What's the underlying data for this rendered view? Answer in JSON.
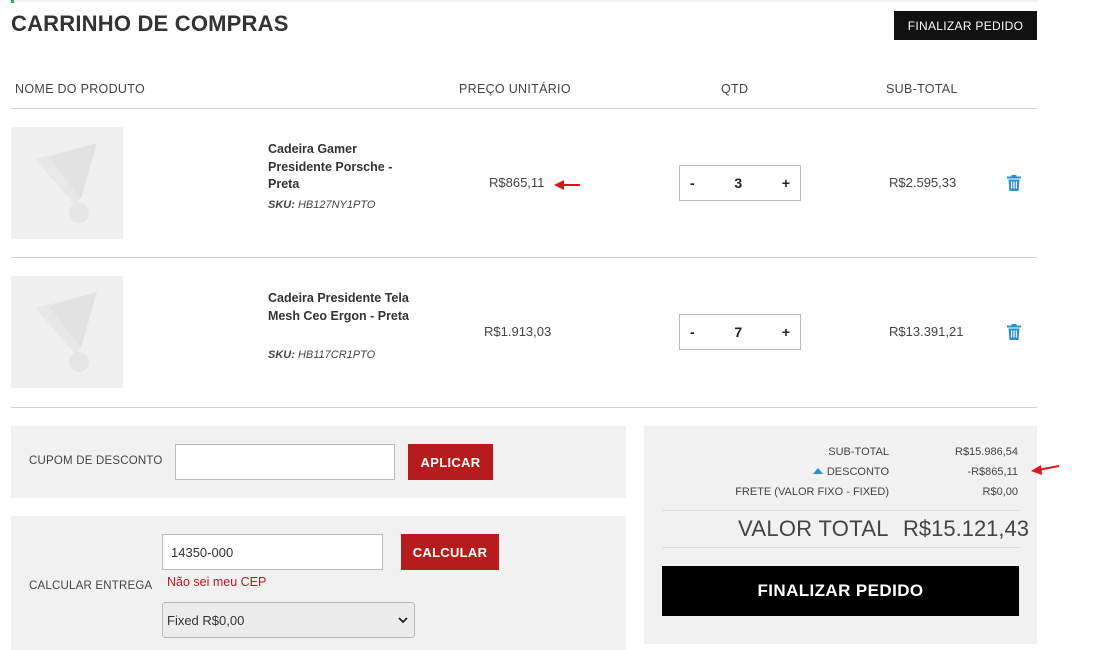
{
  "header": {
    "title": "CARRINHO DE COMPRAS",
    "checkout_top_label": "FINALIZAR PEDIDO"
  },
  "table_headers": {
    "product": "NOME DO PRODUTO",
    "unit_price": "PREÇO UNITÁRIO",
    "qty": "QTD",
    "subtotal": "SUB-TOTAL"
  },
  "items": [
    {
      "name": "Cadeira Gamer Presidente Porsche - Preta",
      "sku_label": "SKU:",
      "sku": "HB127NY1PTO",
      "unit_price": "R$865,11",
      "qty": "3",
      "minus": "-",
      "plus": "+",
      "subtotal": "R$2.595,33",
      "image_icon": "placeholder-image-icon"
    },
    {
      "name": "Cadeira Presidente Tela Mesh Ceo Ergon - Preta",
      "sku_label": "SKU:",
      "sku": "HB117CR1PTO",
      "unit_price": "R$1.913,03",
      "qty": "7",
      "minus": "-",
      "plus": "+",
      "subtotal": "R$13.391,21",
      "image_icon": "placeholder-image-icon"
    }
  ],
  "coupon": {
    "label": "CUPOM DE DESCONTO",
    "value": "",
    "button": "APLICAR"
  },
  "shipping": {
    "label": "CALCULAR ENTREGA",
    "cep_value": "14350-000",
    "button": "CALCULAR",
    "link": "Não sei meu CEP",
    "selected_option": "Fixed R$0,00"
  },
  "summary": {
    "subtotal_label": "SUB-TOTAL",
    "subtotal_value": "R$15.986,54",
    "discount_label": "DESCONTO",
    "discount_value": "-R$865,11",
    "freight_label": "FRETE (VALOR FIXO - FIXED)",
    "freight_value": "R$0,00",
    "total_label": "VALOR TOTAL",
    "total_value": "R$15.121,43",
    "checkout_label": "FINALIZAR PEDIDO"
  },
  "colors": {
    "accent_red": "#b71c1c",
    "trash_blue": "#2a8fd0",
    "annotation_red": "#e0141e"
  }
}
